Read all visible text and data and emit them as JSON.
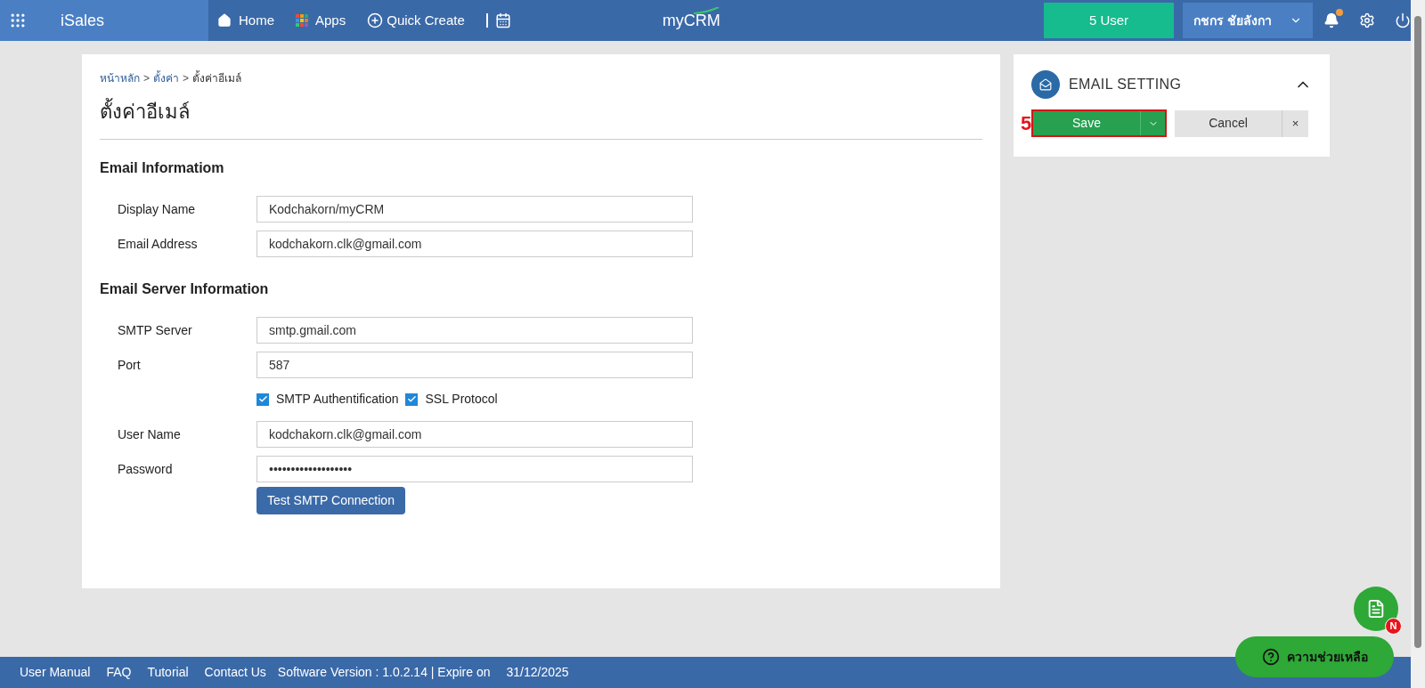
{
  "topbar": {
    "app_name": "iSales",
    "nav": [
      {
        "kind": "home",
        "label": "Home"
      },
      {
        "kind": "apps",
        "label": "Apps"
      },
      {
        "kind": "create",
        "label": "Quick Create"
      },
      {
        "kind": "calendar"
      }
    ],
    "logo": "myCRM",
    "users_button": "5 User",
    "user_menu": "กชกร ชัยลังกา",
    "notification_dot": true
  },
  "breadcrumb": [
    {
      "label": "หน้าหลัก",
      "link": true
    },
    {
      "separator": ">"
    },
    {
      "label": "ตั้งค่า",
      "link": true
    },
    {
      "separator": ">"
    },
    {
      "label": "ตั้งค่าอีเมล์",
      "link": false
    }
  ],
  "page_title": "ตั้งค่าอีเมล์",
  "sections": [
    {
      "title": "Email Informatiom",
      "rows": [
        {
          "kind": "field",
          "label": "Display Name",
          "value": "Kodchakorn/myCRM"
        },
        {
          "kind": "field",
          "label": "Email Address",
          "value": "kodchakorn.clk@gmail.com"
        }
      ]
    },
    {
      "title": "Email Server Information",
      "rows": [
        {
          "kind": "field",
          "label": "SMTP Server",
          "value": "smtp.gmail.com"
        },
        {
          "kind": "field",
          "label": "Port",
          "value": "587"
        },
        {
          "kind": "checks",
          "items": [
            {
              "label": "SMTP Authentification",
              "checked": true
            },
            {
              "label": "SSL Protocol",
              "checked": true
            }
          ]
        },
        {
          "kind": "field",
          "label": "User Name",
          "value": "kodchakorn.clk@gmail.com"
        },
        {
          "kind": "field",
          "label": "Password",
          "value": "•••••••••••••••••••"
        }
      ],
      "action_button": "Test SMTP Connection"
    }
  ],
  "side_panel": {
    "title": "EMAIL SETTING",
    "expanded": true,
    "save": "Save",
    "cancel": "Cancel",
    "close": "×",
    "annotation": "5",
    "highlighted": true
  },
  "footer": {
    "links": [
      "User Manual",
      "FAQ",
      "Tutorial",
      "Contact Us"
    ],
    "version": "Software Version : 1.0.2.14 | Expire on",
    "expire": "31/12/2025"
  },
  "help_button": "ความช่วยเหลือ",
  "notes_badge": "N"
}
